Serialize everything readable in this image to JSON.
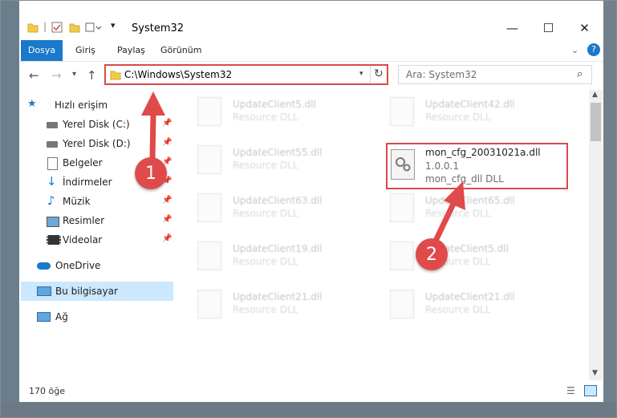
{
  "window": {
    "title": "System32"
  },
  "ribbon": {
    "tabs": [
      "Dosya",
      "Giriş",
      "Paylaş",
      "Görünüm"
    ]
  },
  "address": {
    "path": "C:\\Windows\\System32"
  },
  "search": {
    "placeholder": "Ara: System32"
  },
  "sidebar": {
    "items": [
      {
        "label": "Hızlı erişim",
        "icon": "star-icon"
      },
      {
        "label": "Yerel Disk (C:)",
        "icon": "drive-icon"
      },
      {
        "label": "Yerel Disk (D:)",
        "icon": "drive-icon"
      },
      {
        "label": "Belgeler",
        "icon": "documents-icon"
      },
      {
        "label": "İndirmeler",
        "icon": "download-icon"
      },
      {
        "label": "Müzik",
        "icon": "music-icon"
      },
      {
        "label": "Resimler",
        "icon": "pictures-icon"
      },
      {
        "label": "Videolar",
        "icon": "video-icon"
      },
      {
        "label": "OneDrive",
        "icon": "cloud-icon"
      },
      {
        "label": "Bu bilgisayar",
        "icon": "computer-icon"
      },
      {
        "label": "Ağ",
        "icon": "network-icon"
      }
    ]
  },
  "files": [
    {
      "name": "UpdateClient5.dll",
      "type": "Resource DLL"
    },
    {
      "name": "UpdateClient42.dll",
      "type": "Resource DLL"
    },
    {
      "name": "UpdateClient55.dll",
      "type": "Resource DLL"
    },
    {
      "name": "UpdateClient63.dll",
      "type": "Resource DLL"
    },
    {
      "name": "UpdateClient65.dll",
      "type": "Resource DLL"
    },
    {
      "name": "UpdateClient19.dll",
      "type": "Resource DLL"
    },
    {
      "name": "UpdateClient5.dll",
      "type": "Resource DLL"
    },
    {
      "name": "UpdateClient21.dll",
      "type": "Resource DLL"
    },
    {
      "name": "UpdateClient21.dll",
      "type": "Resource DLL"
    }
  ],
  "highlighted": {
    "name": "mon_cfg_20031021a.dll",
    "version": "1.0.0.1",
    "description": "mon_cfg_dll DLL"
  },
  "status": {
    "count": "170 öğe"
  },
  "annotations": {
    "step1": "1",
    "step2": "2"
  },
  "colors": {
    "annotation": "#e04a4a",
    "ribbon_active": "#1979ca",
    "selection": "#cce8ff"
  }
}
